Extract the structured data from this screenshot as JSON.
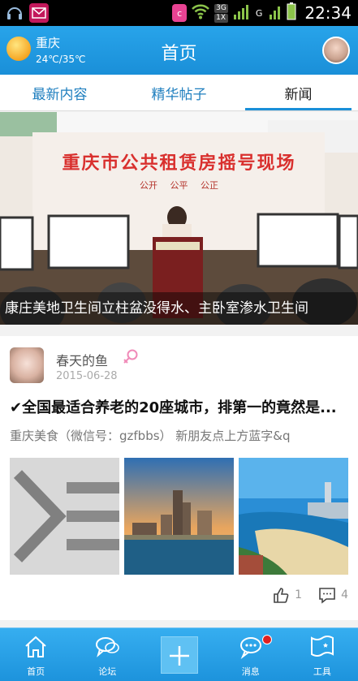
{
  "status_bar": {
    "time": "22:34",
    "network_label": "3G",
    "network_sub": "1X",
    "mobile_label": "G"
  },
  "header": {
    "city": "重庆",
    "temperature": "24℃/35℃",
    "title": "首页"
  },
  "tabs": [
    {
      "label": "最新内容",
      "active": false
    },
    {
      "label": "精华帖子",
      "active": false
    },
    {
      "label": "新闻",
      "active": true
    }
  ],
  "banner": {
    "stage_title": "重庆市公共租赁房摇号现场",
    "stage_subtitle": "公开 公平 公正",
    "caption": "康庄美地卫生间立柱盆没得水、主卧室渗水卫生间"
  },
  "post": {
    "username": "春天的鱼",
    "date": "2015-06-28",
    "title": "✔全国最适合养老的20座城市，排第一的竟然是...",
    "excerpt": "重庆美食（微信号：gzfbbs） 新朋友点上方蓝字&q",
    "likes": "1",
    "comments": "4"
  },
  "bottom_nav": [
    {
      "label": "首页",
      "icon": "home-icon"
    },
    {
      "label": "论坛",
      "icon": "chat-bubble-icon"
    },
    {
      "label": "",
      "icon": "plus-icon"
    },
    {
      "label": "消息",
      "icon": "message-icon",
      "badge": true
    },
    {
      "label": "工具",
      "icon": "tools-icon"
    }
  ],
  "colors": {
    "accent": "#1a8fd8",
    "tab_text": "#1f7fbf",
    "badge": "#e02020"
  }
}
